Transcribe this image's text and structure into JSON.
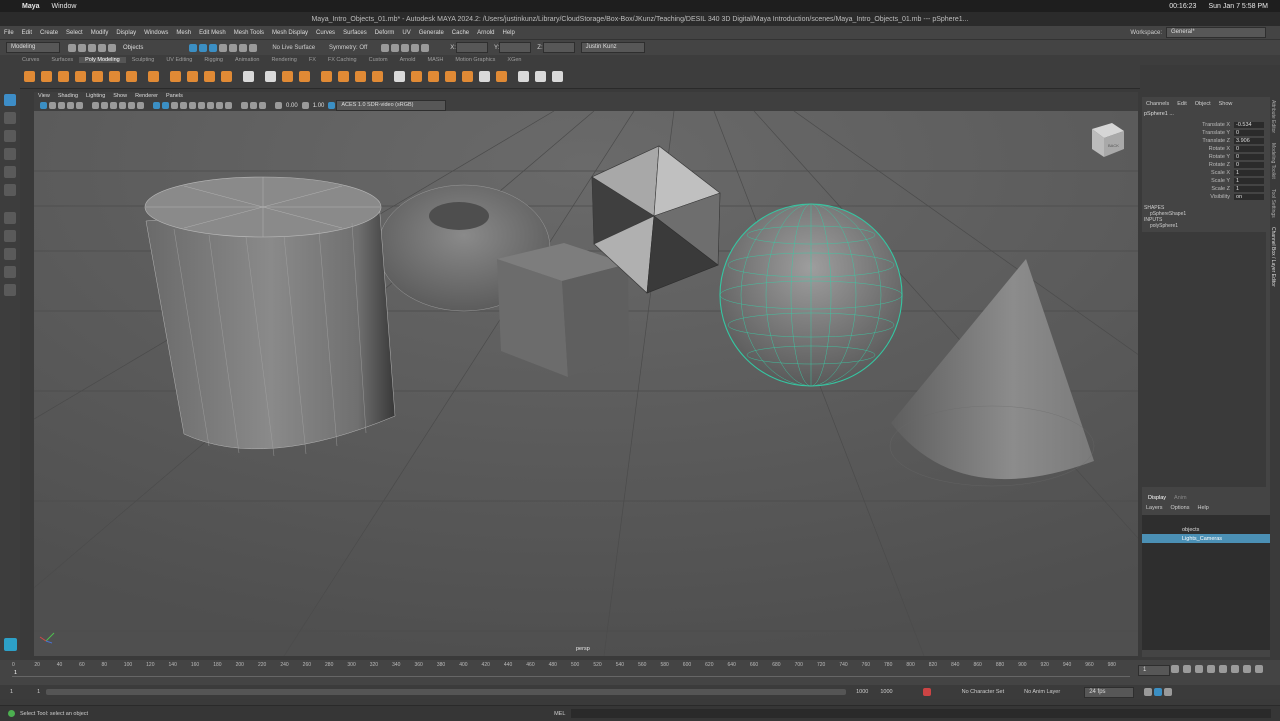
{
  "mac_menubar": {
    "apple": "",
    "app_name": "Maya",
    "menu": [
      "Window"
    ],
    "status": {
      "timer": "00:16:23",
      "datetime": "Sun Jan 7  5:58 PM"
    }
  },
  "window_title": "Maya_Intro_Objects_01.mb* - Autodesk MAYA 2024.2: /Users/justinkunz/Library/CloudStorage/Box-Box/JKunz/Teaching/DESIL 340 3D Digital/Maya Introduction/scenes/Maya_Intro_Objects_01.mb  ---  pSphere1...",
  "main_menu": [
    "File",
    "Edit",
    "Create",
    "Select",
    "Modify",
    "Display",
    "Windows",
    "Mesh",
    "Edit Mesh",
    "Mesh Tools",
    "Mesh Display",
    "Curves",
    "Surfaces",
    "Deform",
    "UV",
    "Generate",
    "Cache",
    "Arnold",
    "Help"
  ],
  "workspace": {
    "label": "Workspace:",
    "value": "General*"
  },
  "status_line": {
    "menu_set": "Modeling",
    "objects_label": "Objects",
    "live_surface": "No Live Surface",
    "symmetry": "Symmetry: Off",
    "x_label": "X:",
    "y_label": "Y:",
    "z_label": "Z:",
    "user": "Justin Kunz"
  },
  "shelf_tabs": [
    "Curves",
    "Surfaces",
    "Poly Modeling",
    "Sculpting",
    "UV Editing",
    "Rigging",
    "Animation",
    "Rendering",
    "FX",
    "FX Caching",
    "Custom",
    "Arnold",
    "MASH",
    "Motion Graphics",
    "XGen"
  ],
  "active_shelf_tab": "Poly Modeling",
  "viewport": {
    "menu": [
      "View",
      "Shading",
      "Lighting",
      "Show",
      "Renderer",
      "Panels"
    ],
    "exposure": "0.00",
    "gamma": "1.00",
    "colorspace": "ACES 1.0 SDR-video (sRGB)",
    "camera_label": "persp",
    "cube_label": "BACK"
  },
  "channel_box": {
    "menu": [
      "Channels",
      "Edit",
      "Object",
      "Show"
    ],
    "object": "pSphere1 ...",
    "attributes": [
      {
        "label": "Translate X",
        "value": "-0.534"
      },
      {
        "label": "Translate Y",
        "value": "0"
      },
      {
        "label": "Translate Z",
        "value": "3.906"
      },
      {
        "label": "Rotate X",
        "value": "0"
      },
      {
        "label": "Rotate Y",
        "value": "0"
      },
      {
        "label": "Rotate Z",
        "value": "0"
      },
      {
        "label": "Scale X",
        "value": "1"
      },
      {
        "label": "Scale Y",
        "value": "1"
      },
      {
        "label": "Scale Z",
        "value": "1"
      },
      {
        "label": "Visibility",
        "value": "on"
      }
    ],
    "shapes_header": "SHAPES",
    "shape": "pSphereShape1",
    "inputs_header": "INPUTS",
    "input": "polySphere1"
  },
  "layer_editor": {
    "tabs": [
      "Display",
      "Anim"
    ],
    "menu": [
      "Layers",
      "Options",
      "Help"
    ],
    "layers": [
      {
        "name": "objects",
        "selected": false
      },
      {
        "name": "Lights_Cameras",
        "selected": true
      }
    ]
  },
  "side_tabs": [
    "Attribute Editor",
    "Modeling Toolkit",
    "Tool Settings",
    "Channel Box / Layer Editor"
  ],
  "timeline": {
    "ticks": [
      "0",
      "20",
      "40",
      "60",
      "80",
      "100",
      "120",
      "140",
      "160",
      "180",
      "200",
      "220",
      "240",
      "260",
      "280",
      "300",
      "320",
      "340",
      "360",
      "380",
      "400",
      "420",
      "440",
      "460",
      "480",
      "500",
      "520",
      "540",
      "560",
      "580",
      "600",
      "620",
      "640",
      "660",
      "680",
      "700",
      "720",
      "740",
      "760",
      "780",
      "800",
      "820",
      "840",
      "860",
      "880",
      "900",
      "920",
      "940",
      "960",
      "980"
    ],
    "current_frame": "1",
    "current_frame_field": "1"
  },
  "range": {
    "start": "1",
    "start2": "1",
    "end": "1000",
    "end2": "1000",
    "character_set": "No Character Set",
    "anim_layer": "No Anim Layer",
    "fps": "24 fps"
  },
  "help_line": {
    "text": "Select Tool: select an object",
    "mel": "MEL"
  }
}
